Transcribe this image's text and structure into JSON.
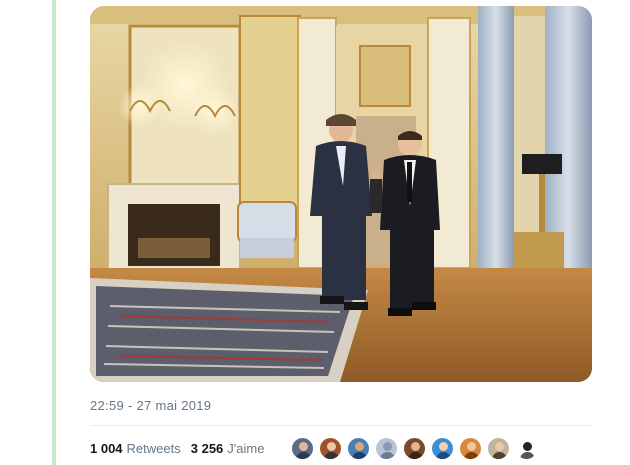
{
  "tweet": {
    "timestamp": "22:59 - 27 mai 2019",
    "stats": {
      "retweets_count": "1 004",
      "retweets_label": "Retweets",
      "likes_count": "3 256",
      "likes_label": "J'aime"
    },
    "photo": {
      "scene": "two men in suits walking through an ornate gilded palace salon"
    },
    "liked_by_avatars": [
      {
        "bg": "#5b6b86",
        "head": "#e0b899",
        "body": "#2c3a52"
      },
      {
        "bg": "#a0522d",
        "head": "#f0c8a8",
        "body": "#333333"
      },
      {
        "bg": "#4a7fb5",
        "head": "#d9a77c",
        "body": "#1f3f66"
      },
      {
        "bg": "#b8c4d6",
        "head": "#8a98b0",
        "body": "#6d7b92"
      },
      {
        "bg": "#7a4a2e",
        "head": "#e6b48c",
        "body": "#3b2416"
      },
      {
        "bg": "#3f8fd0",
        "head": "#f2d0b0",
        "body": "#1a4f80"
      },
      {
        "bg": "#d8893e",
        "head": "#f0c89e",
        "body": "#7c3f12"
      },
      {
        "bg": "#c2b49a",
        "head": "#e8c9a8",
        "body": "#4d4436"
      },
      {
        "bg": "#ffffff",
        "head": "#222222",
        "body": "#555555"
      }
    ]
  },
  "colors": {
    "muted_text": "#657786",
    "strong_text": "#14171a",
    "rail": "#c8e6c9"
  }
}
